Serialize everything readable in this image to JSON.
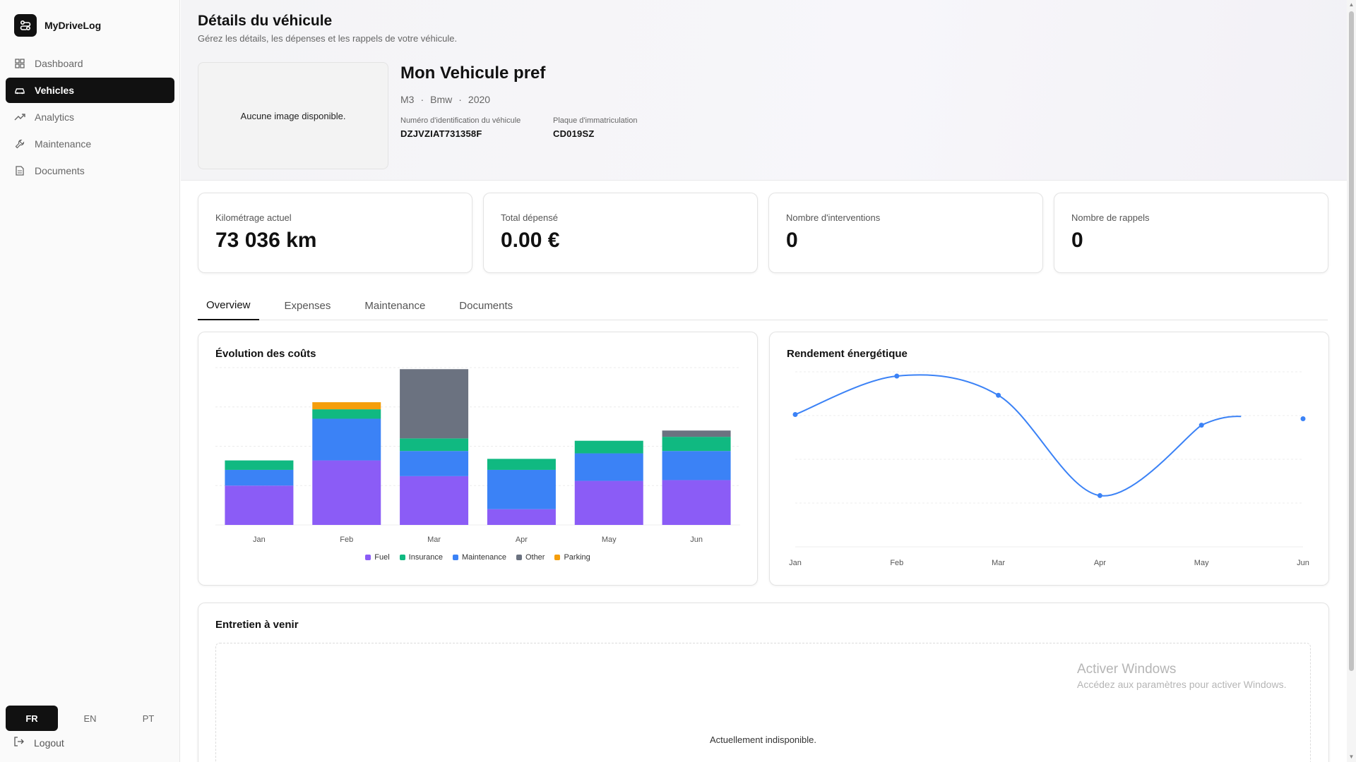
{
  "app": {
    "name": "MyDriveLog"
  },
  "sidebar": {
    "items": [
      {
        "label": "Dashboard",
        "icon": "grid-icon"
      },
      {
        "label": "Vehicles",
        "icon": "car-icon",
        "active": true
      },
      {
        "label": "Analytics",
        "icon": "trend-icon"
      },
      {
        "label": "Maintenance",
        "icon": "wrench-icon"
      },
      {
        "label": "Documents",
        "icon": "file-icon"
      }
    ],
    "languages": [
      "FR",
      "EN",
      "PT"
    ],
    "active_language": "FR",
    "logout_label": "Logout"
  },
  "header": {
    "title": "Détails du véhicule",
    "subtitle": "Gérez les détails, les dépenses et les rappels de votre véhicule.",
    "no_image": "Aucune image disponible."
  },
  "vehicle": {
    "name": "Mon Vehicule pref",
    "model": "M3",
    "brand": "Bmw",
    "year": "2020",
    "separator": "·",
    "vin_label": "Numéro d'identification du véhicule",
    "vin": "DZJVZIAT731358F",
    "plate_label": "Plaque d'immatriculation",
    "plate": "CD019SZ"
  },
  "stats": [
    {
      "label": "Kilométrage actuel",
      "value": "73 036 km"
    },
    {
      "label": "Total dépensé",
      "value": "0.00 €"
    },
    {
      "label": "Nombre d'interventions",
      "value": "0"
    },
    {
      "label": "Nombre de rappels",
      "value": "0"
    }
  ],
  "tabs": [
    {
      "label": "Overview",
      "active": true
    },
    {
      "label": "Expenses"
    },
    {
      "label": "Maintenance"
    },
    {
      "label": "Documents"
    }
  ],
  "cost_chart": {
    "title": "Évolution des coûts"
  },
  "efficiency_chart": {
    "title": "Rendement énergétique"
  },
  "chart_data": [
    {
      "type": "bar",
      "stacked": true,
      "title": "Évolution des coûts",
      "categories": [
        "Jan",
        "Feb",
        "Mar",
        "Apr",
        "May",
        "Jun"
      ],
      "ylim": [
        0,
        200
      ],
      "grid": true,
      "legend_position": "bottom",
      "series": [
        {
          "name": "Fuel",
          "color": "#8b5cf6",
          "values": [
            50,
            82,
            62,
            20,
            56,
            57
          ]
        },
        {
          "name": "Maintenance",
          "color": "#3b82f6",
          "values": [
            20,
            53,
            32,
            50,
            35,
            37
          ]
        },
        {
          "name": "Insurance",
          "color": "#10b981",
          "values": [
            12,
            12,
            16,
            14,
            16,
            18
          ]
        },
        {
          "name": "Other",
          "color": "#6b7280",
          "values": [
            0,
            0,
            88,
            0,
            0,
            8
          ]
        },
        {
          "name": "Parking",
          "color": "#f59e0b",
          "values": [
            0,
            9,
            0,
            0,
            0,
            0
          ]
        }
      ],
      "legend_order": [
        "Fuel",
        "Insurance",
        "Maintenance",
        "Other",
        "Parking"
      ]
    },
    {
      "type": "line",
      "title": "Rendement énergétique",
      "categories": [
        "Jan",
        "Feb",
        "Mar",
        "Apr",
        "May",
        "Jun"
      ],
      "values": [
        6.2,
        8.0,
        7.1,
        2.4,
        5.7,
        6.0
      ],
      "ylim": [
        0,
        8.2
      ],
      "smooth": true,
      "grid": true,
      "color": "#3b82f6"
    }
  ],
  "upcoming": {
    "title": "Entretien à venir",
    "empty_message": "Actuellement indisponible."
  },
  "watermark": {
    "line1": "Activer Windows",
    "line2": "Accédez aux paramètres pour activer Windows."
  }
}
